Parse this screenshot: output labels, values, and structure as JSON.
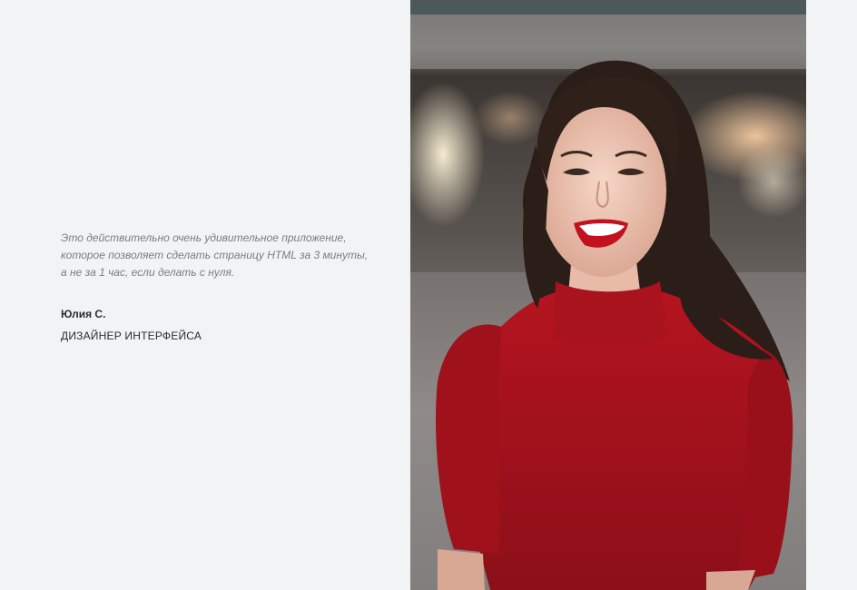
{
  "testimonial": {
    "quote": "Это действительно очень удивительное приложение, которое позволяет сделать страницу HTML за 3 минуты, а не за 1 час, если делать с нуля.",
    "author_name": "Юлия С.",
    "author_role": "ДИЗАЙНЕР ИНТЕРФЕЙСА"
  },
  "photo": {
    "icon": "portrait-photo"
  },
  "colors": {
    "page_background": "#f2f3f5",
    "quote_text": "#7a7d80",
    "author_text": "#2a2d2f",
    "sweater": "#a5121d"
  }
}
